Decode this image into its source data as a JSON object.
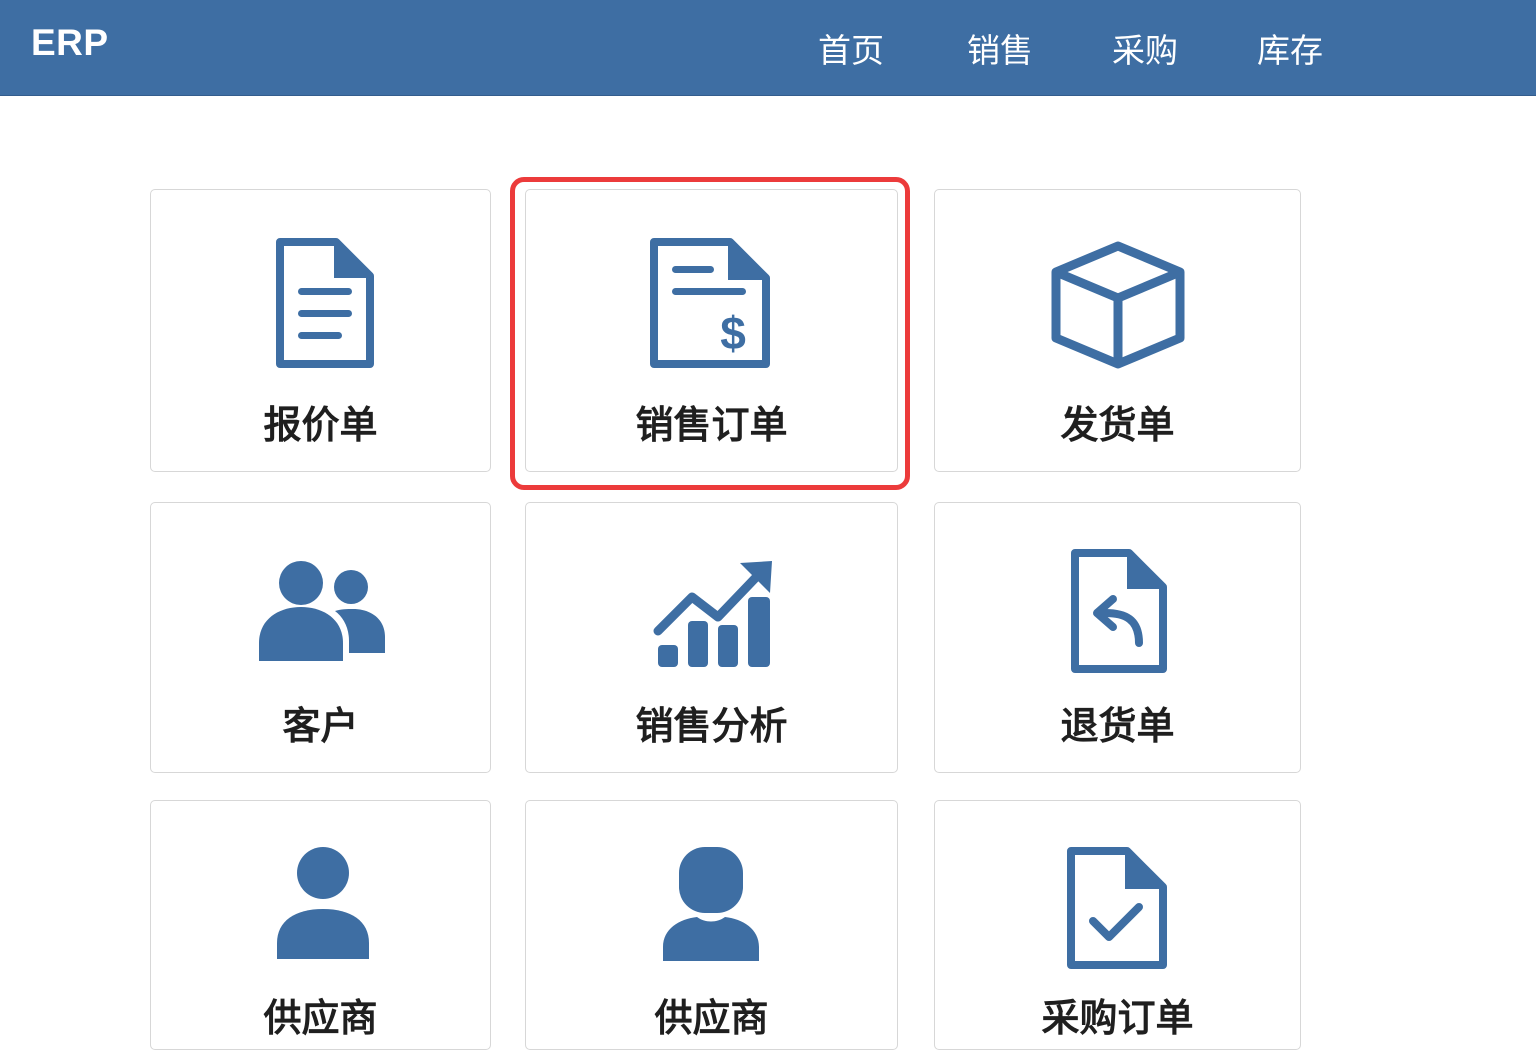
{
  "app": {
    "brand": "ERP"
  },
  "nav": [
    {
      "label": "首页"
    },
    {
      "label": "销售"
    },
    {
      "label": "采购"
    },
    {
      "label": "库存"
    }
  ],
  "tiles": [
    {
      "label": "报价单",
      "icon": "document-lines-icon"
    },
    {
      "label": "销售订单",
      "icon": "document-dollar-icon",
      "highlighted": true
    },
    {
      "label": "发货单",
      "icon": "box-icon"
    },
    {
      "label": "客户",
      "icon": "users-icon"
    },
    {
      "label": "销售分析",
      "icon": "bar-chart-trend-icon"
    },
    {
      "label": "退货单",
      "icon": "document-return-icon"
    },
    {
      "label": "供应商",
      "icon": "person-icon"
    },
    {
      "label": "供应商",
      "icon": "person-rounded-icon"
    },
    {
      "label": "采购订单",
      "icon": "document-check-icon"
    }
  ],
  "colors": {
    "header": "#3e6ea3",
    "icon": "#3e6ea3",
    "highlight": "#ec3b3b",
    "tile_border": "#d7d7d7"
  }
}
